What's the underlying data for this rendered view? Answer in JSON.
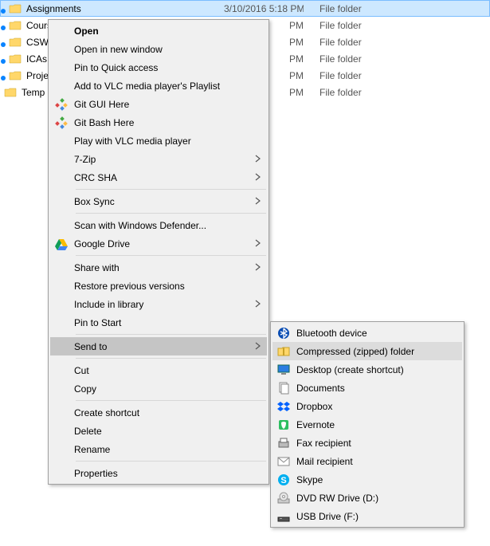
{
  "files": [
    {
      "name": "Assignments",
      "date": "3/10/2016 5:18 PM",
      "type": "File folder",
      "pinned": true,
      "selected": true
    },
    {
      "name": "Cours",
      "date": "PM",
      "type": "File folder",
      "pinned": true
    },
    {
      "name": "CSWA",
      "date": "PM",
      "type": "File folder",
      "pinned": true
    },
    {
      "name": "ICAs",
      "date": "PM",
      "type": "File folder",
      "pinned": true
    },
    {
      "name": "Projec",
      "date": "PM",
      "type": "File folder",
      "pinned": true
    },
    {
      "name": "Temp",
      "date": "PM",
      "type": "File folder",
      "pinned": false
    }
  ],
  "menu": {
    "open": "Open",
    "open_new_window": "Open in new window",
    "pin_quick_access": "Pin to Quick access",
    "add_vlc": "Add to VLC media player's Playlist",
    "git_gui": "Git GUI Here",
    "git_bash": "Git Bash Here",
    "play_vlc": "Play with VLC media player",
    "seven_zip": "7-Zip",
    "crc_sha": "CRC SHA",
    "box_sync": "Box Sync",
    "defender": "Scan with Windows Defender...",
    "google_drive": "Google Drive",
    "share_with": "Share with",
    "restore_prev": "Restore previous versions",
    "include_library": "Include in library",
    "pin_start": "Pin to Start",
    "send_to": "Send to",
    "cut": "Cut",
    "copy": "Copy",
    "create_shortcut": "Create shortcut",
    "delete": "Delete",
    "rename": "Rename",
    "properties": "Properties"
  },
  "sendto": {
    "bluetooth": "Bluetooth device",
    "compressed": "Compressed (zipped) folder",
    "desktop": "Desktop (create shortcut)",
    "documents": "Documents",
    "dropbox": "Dropbox",
    "evernote": "Evernote",
    "fax": "Fax recipient",
    "mail": "Mail recipient",
    "skype": "Skype",
    "dvd": "DVD RW Drive (D:)",
    "usb": "USB Drive (F:)"
  }
}
